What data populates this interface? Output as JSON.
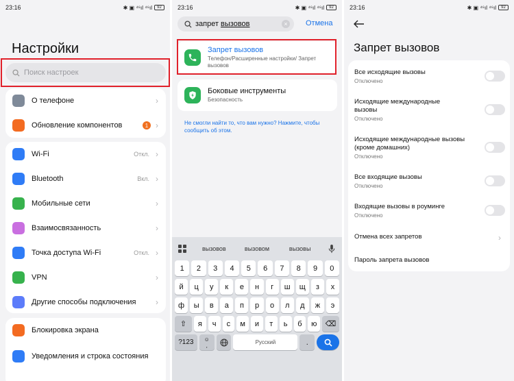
{
  "colors": {
    "accent": "#1a73e8",
    "highlight": "#e0202a",
    "toggle_off": "#e4e4e7"
  },
  "panel1": {
    "status_time": "23:16",
    "status_icons": "✱ ▣ ⁴⁶ıl ⁴⁶ıl",
    "battery": "92",
    "title": "Настройки",
    "search_placeholder": "Поиск настроек",
    "group1": [
      {
        "icon": "phone-info-icon",
        "color": "#7f8a99",
        "label": "О телефоне",
        "value": "",
        "badge": ""
      },
      {
        "icon": "update-icon",
        "color": "#f36b21",
        "label": "Обновление компонентов",
        "value": "",
        "badge": "1"
      }
    ],
    "group2": [
      {
        "icon": "wifi-icon",
        "color": "#2f7cf6",
        "label": "Wi-Fi",
        "value": "Откл."
      },
      {
        "icon": "bluetooth-icon",
        "color": "#2f7cf6",
        "label": "Bluetooth",
        "value": "Вкл."
      },
      {
        "icon": "mobile-network-icon",
        "color": "#37b24d",
        "label": "Мобильные сети",
        "value": ""
      },
      {
        "icon": "connectivity-icon",
        "color": "#c96fe0",
        "label": "Взаимосвязанность",
        "value": ""
      },
      {
        "icon": "hotspot-icon",
        "color": "#2f7cf6",
        "label": "Точка доступа Wi-Fi",
        "value": "Откл."
      },
      {
        "icon": "vpn-icon",
        "color": "#37b24d",
        "label": "VPN",
        "value": ""
      },
      {
        "icon": "link-icon",
        "color": "#5c7cfa",
        "label": "Другие способы подключения",
        "value": ""
      }
    ],
    "group3": [
      {
        "icon": "lock-icon",
        "color": "#f36b21",
        "label": "Блокировка экрана"
      },
      {
        "icon": "notification-icon",
        "color": "#2f7cf6",
        "label": "Уведомления и строка состояния"
      }
    ]
  },
  "panel2": {
    "status_time": "23:16",
    "status_icons": "✱ ▣ ⁴⁶ıl ⁴⁶ıl",
    "battery": "92",
    "search_prefix": "запрет",
    "search_word": "вызовов",
    "cancel": "Отмена",
    "results": [
      {
        "title": "Запрет вызовов",
        "subtitle": "Телефон/Расширенные настройки/ Запрет вызовов"
      },
      {
        "title": "Боковые инструменты",
        "subtitle": "Безопасность"
      }
    ],
    "hint": "Не смогли найти то, что вам нужно? Нажмите, чтобы сообщить об этом.",
    "suggestions": [
      "вызовов",
      "вызовом",
      "вызовы"
    ],
    "keys_row1": [
      "1",
      "2",
      "3",
      "4",
      "5",
      "6",
      "7",
      "8",
      "9",
      "0"
    ],
    "keys_row2": [
      "й",
      "ц",
      "у",
      "к",
      "е",
      "н",
      "г",
      "ш",
      "щ",
      "з",
      "х"
    ],
    "keys_row3": [
      "ф",
      "ы",
      "в",
      "а",
      "п",
      "р",
      "о",
      "л",
      "д",
      "ж",
      "э"
    ],
    "keys_row4": [
      "я",
      "ч",
      "с",
      "м",
      "и",
      "т",
      "ь",
      "б",
      "ю"
    ],
    "key_123": "?123",
    "key_comma": ",",
    "key_emoji": "☺",
    "space_label": "Русский",
    "key_period": "."
  },
  "panel3": {
    "status_time": "23:16",
    "status_icons": "✱ ▣ ⁴⁶ıl ⁴⁶ıl",
    "battery": "92",
    "title": "Запрет вызовов",
    "options": [
      {
        "title": "Все исходящие вызовы",
        "sub": "Отключено"
      },
      {
        "title": "Исходящие международные вызовы",
        "sub": "Отключено"
      },
      {
        "title": "Исходящие международные вызовы (кроме домашних)",
        "sub": "Отключено"
      },
      {
        "title": "Все входящие вызовы",
        "sub": "Отключено"
      },
      {
        "title": "Входящие вызовы в роуминге",
        "sub": "Отключено"
      }
    ],
    "cancel_all": "Отмена всех запретов",
    "password": "Пароль запрета вызовов"
  }
}
